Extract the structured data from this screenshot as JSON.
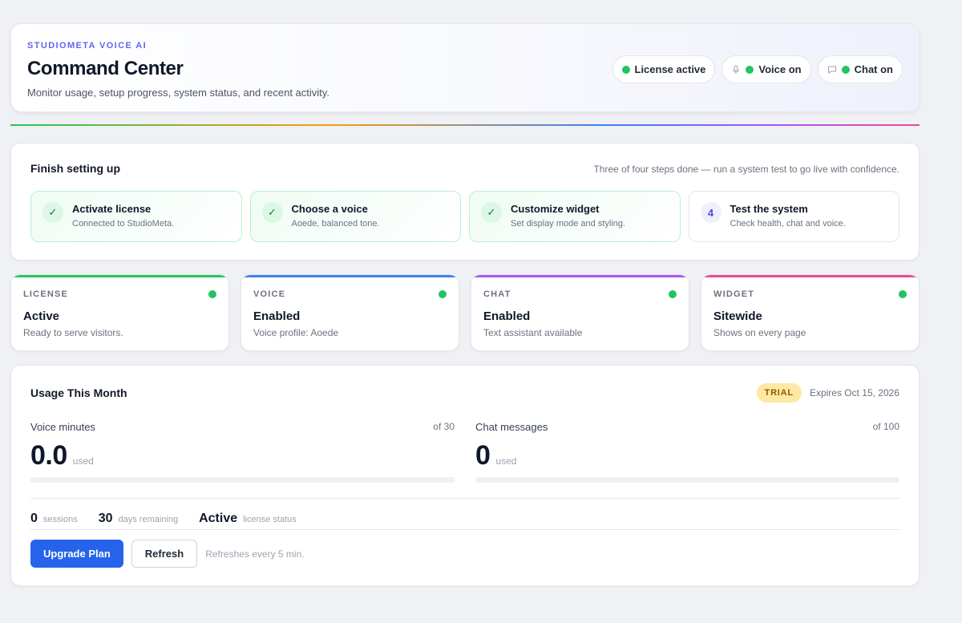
{
  "header": {
    "eyebrow": "STUDIOMETA VOICE AI",
    "title": "Command Center",
    "subtitle": "Monitor usage, setup progress, system status, and recent activity.",
    "pills": [
      {
        "label": "License active",
        "icon": "status-dot"
      },
      {
        "label": "Voice on",
        "icon": "microphone-icon"
      },
      {
        "label": "Chat on",
        "icon": "chat-bubble-icon"
      }
    ]
  },
  "setup": {
    "title": "Finish setting up",
    "hint": "Three of four steps done — run a system test to go live with confidence.",
    "steps": [
      {
        "badge": "✓",
        "name": "Activate license",
        "desc": "Connected to StudioMeta.",
        "done": true
      },
      {
        "badge": "✓",
        "name": "Choose a voice",
        "desc": "Aoede, balanced tone.",
        "done": true
      },
      {
        "badge": "✓",
        "name": "Customize widget",
        "desc": "Set display mode and styling.",
        "done": true
      },
      {
        "badge": "4",
        "name": "Test the system",
        "desc": "Check health, chat and voice.",
        "done": false
      }
    ]
  },
  "status_cards": [
    {
      "label": "LICENSE",
      "value": "Active",
      "desc": "Ready to serve visitors.",
      "accent": "#22c55e"
    },
    {
      "label": "VOICE",
      "value": "Enabled",
      "desc": "Voice profile: Aoede",
      "accent": "#3b82f6"
    },
    {
      "label": "CHAT",
      "value": "Enabled",
      "desc": "Text assistant available",
      "accent": "#a855f7"
    },
    {
      "label": "WIDGET",
      "value": "Sitewide",
      "desc": "Shows on every page",
      "accent": "#ec4899"
    }
  ],
  "usage": {
    "title": "Usage This Month",
    "badge": "TRIAL",
    "expires": "Expires Oct 15, 2026",
    "meters": [
      {
        "label": "Voice minutes",
        "of": "of 30",
        "value": "0.0",
        "unit": "used",
        "progress": 0
      },
      {
        "label": "Chat messages",
        "of": "of 100",
        "value": "0",
        "unit": "used",
        "progress": 0
      }
    ],
    "stats": [
      {
        "num": "0",
        "label": "sessions"
      },
      {
        "num": "30",
        "label": "days remaining"
      },
      {
        "num": "Active",
        "label": "license status"
      }
    ],
    "upgrade_label": "Upgrade Plan",
    "refresh_label": "Refresh",
    "refresh_note": "Refreshes every 5 min."
  },
  "colors": {
    "accent": "#2563eb",
    "success": "#22c55e",
    "brand": "#6366f1"
  }
}
